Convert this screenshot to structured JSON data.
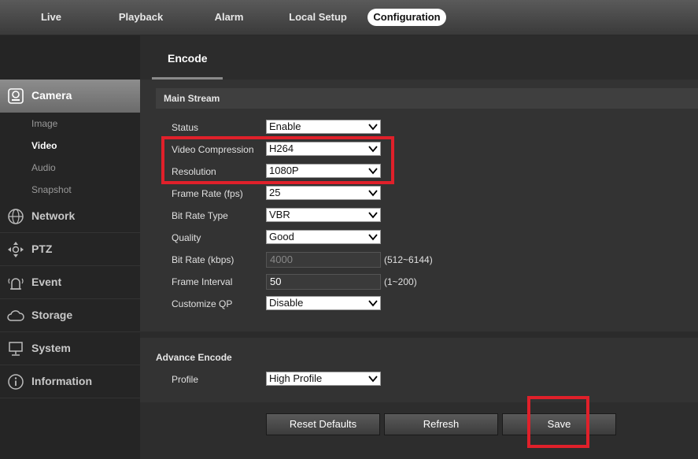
{
  "topnav": {
    "tabs": [
      {
        "label": "Live"
      },
      {
        "label": "Playback"
      },
      {
        "label": "Alarm"
      },
      {
        "label": "Local Setup"
      },
      {
        "label": "Configuration",
        "active": true
      }
    ]
  },
  "sidebar": {
    "items": [
      {
        "label": "Camera",
        "icon": "camera-icon",
        "active": true
      },
      {
        "label": "Network",
        "icon": "globe-icon"
      },
      {
        "label": "PTZ",
        "icon": "ptz-icon"
      },
      {
        "label": "Event",
        "icon": "alarm-icon"
      },
      {
        "label": "Storage",
        "icon": "cloud-icon"
      },
      {
        "label": "System",
        "icon": "monitor-icon"
      },
      {
        "label": "Information",
        "icon": "info-icon"
      }
    ],
    "camera_sub": [
      {
        "label": "Image"
      },
      {
        "label": "Video",
        "active": true
      },
      {
        "label": "Audio"
      },
      {
        "label": "Snapshot"
      }
    ]
  },
  "main": {
    "tab_label": "Encode",
    "main_stream": {
      "heading": "Main Stream",
      "status": {
        "label": "Status",
        "value": "Enable"
      },
      "video_compression": {
        "label": "Video Compression",
        "value": "H264"
      },
      "resolution": {
        "label": "Resolution",
        "value": "1080P"
      },
      "frame_rate": {
        "label": "Frame Rate (fps)",
        "value": "25"
      },
      "bit_rate_type": {
        "label": "Bit Rate Type",
        "value": "VBR"
      },
      "quality": {
        "label": "Quality",
        "value": "Good"
      },
      "bit_rate": {
        "label": "Bit Rate (kbps)",
        "value": "4000",
        "range": "(512~6144)"
      },
      "frame_interval": {
        "label": "Frame Interval",
        "value": "50",
        "range": "(1~200)"
      },
      "customize_qp": {
        "label": "Customize QP",
        "value": "Disable"
      }
    },
    "advance": {
      "heading": "Advance Encode",
      "profile": {
        "label": "Profile",
        "value": "High Profile"
      }
    },
    "buttons": {
      "reset": "Reset Defaults",
      "refresh": "Refresh",
      "save": "Save"
    }
  },
  "colors": {
    "highlight": "#e0202a",
    "background": "#1c1c1c",
    "panel": "#333333"
  }
}
